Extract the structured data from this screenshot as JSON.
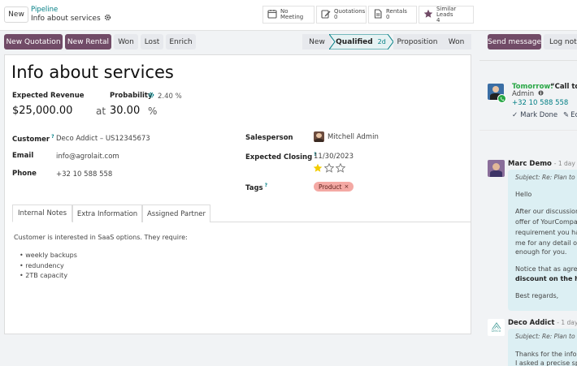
{
  "header": {
    "new_button": "New",
    "breadcrumb_parent": "Pipeline",
    "record_title": "Info about services"
  },
  "smart_buttons": [
    {
      "label": "No Meeting",
      "count": "",
      "icon": "calendar-icon"
    },
    {
      "label": "Quotations",
      "count": "0",
      "icon": "pencil-square-icon"
    },
    {
      "label": "Rentals",
      "count": "0",
      "icon": "document-icon"
    },
    {
      "label": "Similar Leads",
      "count": "4",
      "icon": "star-icon"
    }
  ],
  "toolbar": {
    "new_quotation": "New Quotation",
    "new_rental": "New Rental",
    "won": "Won",
    "lost": "Lost",
    "enrich": "Enrich"
  },
  "stages": [
    {
      "label": "New",
      "days": ""
    },
    {
      "label": "Qualified",
      "days": "2d",
      "active": true
    },
    {
      "label": "Proposition",
      "days": ""
    },
    {
      "label": "Won",
      "days": ""
    }
  ],
  "chatter_actions": {
    "send_message": "Send message",
    "log_note": "Log note"
  },
  "form": {
    "title": "Info about services",
    "expected_revenue_label": "Expected Revenue",
    "expected_revenue": "$25,000.00",
    "at_label": "at",
    "probability_label": "Probability",
    "ai_probability": "2.40 %",
    "probability": "30.00",
    "percent_sign": "%",
    "customer_label": "Customer",
    "customer_value": "Deco Addict – US12345673",
    "email_label": "Email",
    "email_value": "info@agrolait.com",
    "phone_label": "Phone",
    "phone_value": "+32 10 588 558",
    "salesperson_label": "Salesperson",
    "salesperson_value": "Mitchell Admin",
    "expected_closing_label": "Expected Closing",
    "expected_closing_value": "11/30/2023",
    "priority_stars": 1,
    "priority_max": 3,
    "tags_label": "Tags",
    "tag_value": "Product",
    "help_mark": "?"
  },
  "tabs": [
    "Internal Notes",
    "Extra Information",
    "Assigned Partner"
  ],
  "notes": {
    "intro": "Customer is interested in SaaS options. They require:",
    "items": [
      "weekly backups",
      "redundency",
      "2TB capacity"
    ]
  },
  "chatter": {
    "activity": {
      "when": "Tomorrow:",
      "summary": "“Call to",
      "user": "Admin",
      "phone": "+32 10 588 558",
      "mark_done": "Mark Done",
      "edit": "Ec"
    },
    "messages": [
      {
        "author": "Marc Demo",
        "time": "- 1 day ago",
        "subject": "Subject: Re: Plan to b",
        "lines": [
          "Hello",
          "After our discussion",
          "offer of YourCompa",
          "requirement you ha",
          "me for any detail or",
          "enough for you.",
          "Notice that as agree",
          "discount on the har",
          "Best regards,"
        ]
      },
      {
        "author": "Deco Addict",
        "time": "- 1 day ago",
        "subject": "Subject: Re: Plan to b",
        "avatar_text": "Deco",
        "lines": [
          "Thanks for the infor",
          "I asked a precise spe"
        ]
      }
    ]
  },
  "colors": {
    "primary": "#714b67",
    "teal": "#017e84",
    "green": "#28a745",
    "tag_bg": "#f4a9a4",
    "star": "#f3cc00"
  }
}
